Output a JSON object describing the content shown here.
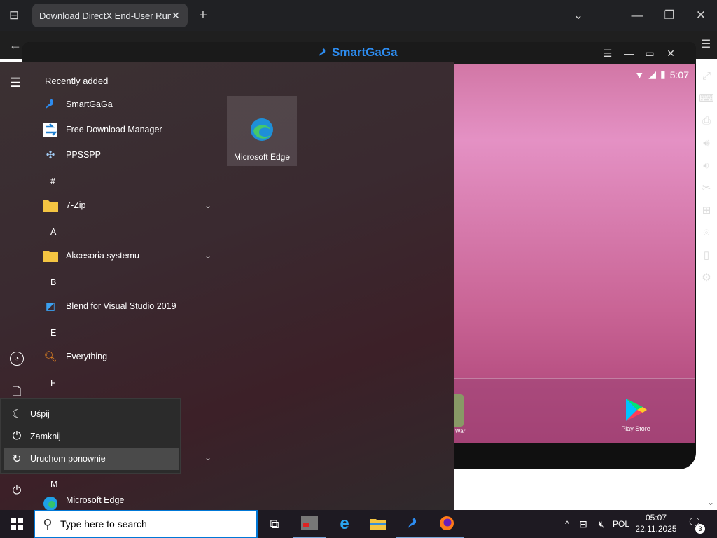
{
  "browser": {
    "tab_title": "Download DirectX End-User Runtim",
    "new_tab": "+",
    "tab_close": "✕",
    "window_minimize": "—",
    "window_restore": "❐",
    "window_close": "✕"
  },
  "emulator": {
    "title": "SmartGaGa",
    "status_time": "5:07",
    "dock_app": "Play Store",
    "partial_app_label": "War",
    "sidebar_icons": [
      "fullscreen-icon",
      "keyboard-icon",
      "apk-install-icon",
      "volume-up-icon",
      "volume-down-icon",
      "screenshot-icon",
      "multi-instance-icon",
      "location-icon",
      "shake-icon",
      "settings-icon"
    ]
  },
  "start_menu": {
    "recently_added_label": "Recently added",
    "recent_apps": [
      {
        "name": "SmartGaGa",
        "icon": "smartgaga-icon"
      },
      {
        "name": "Free Download Manager",
        "icon": "fdm-icon"
      },
      {
        "name": "PPSSPP",
        "icon": "ppsspp-icon"
      }
    ],
    "sections": [
      {
        "letter": "#",
        "app": "7-Zip",
        "expandable": true
      },
      {
        "letter": "A",
        "app": "Akcesoria systemu",
        "expandable": true
      },
      {
        "letter": "B",
        "app": "Blend for Visual Studio 2019",
        "expandable": false
      },
      {
        "letter": "E",
        "app": "Everything",
        "expandable": false
      },
      {
        "letter": "F",
        "app": "",
        "expandable": false
      },
      {
        "letter": "M",
        "app": "Microsoft Edge",
        "expandable": false
      }
    ],
    "tile": {
      "label": "Microsoft Edge"
    },
    "power_menu": [
      {
        "label": "Uśpij",
        "icon": "sleep-icon"
      },
      {
        "label": "Zamknij",
        "icon": "shutdown-icon"
      },
      {
        "label": "Uruchom ponownie",
        "icon": "restart-icon",
        "selected": true
      }
    ]
  },
  "taskbar": {
    "search_placeholder": "Type here to search",
    "language": "POL",
    "time": "05:07",
    "date": "22.11.2025",
    "notification_count": "3"
  }
}
